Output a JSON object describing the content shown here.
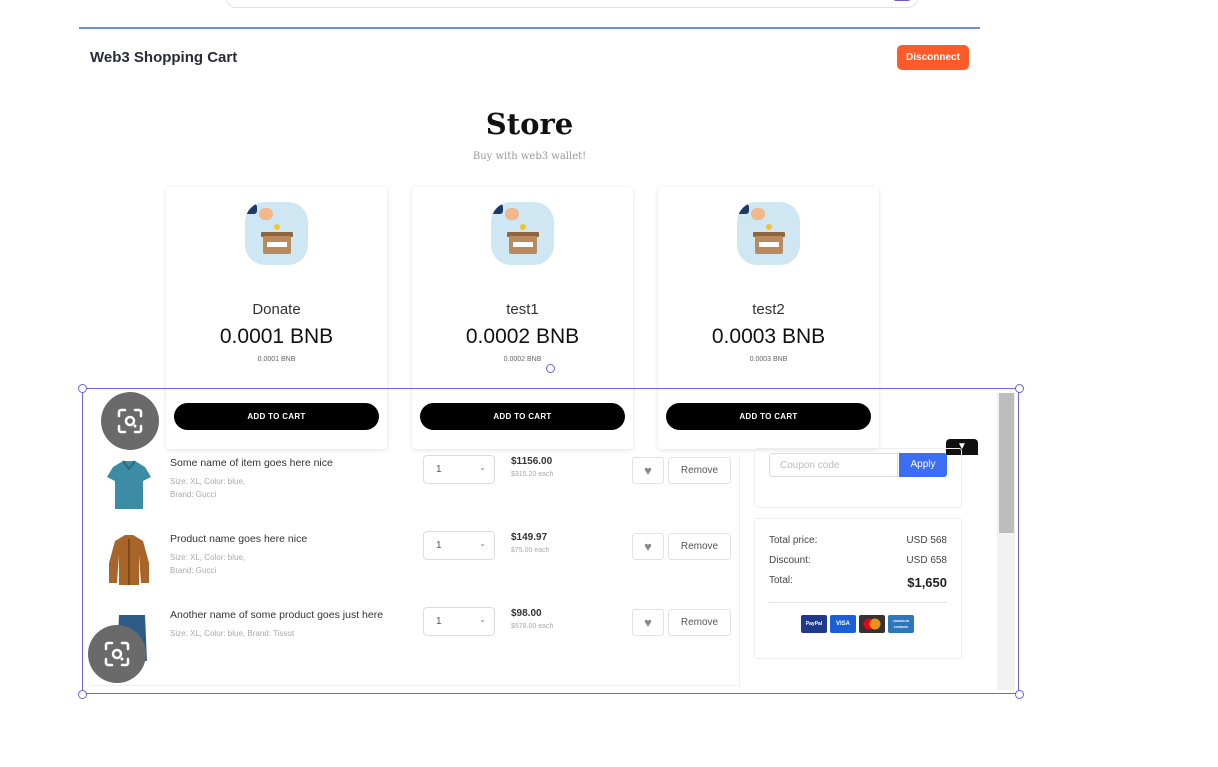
{
  "header": {
    "brand": "Web3 Shopping Cart",
    "disconnect_label": "Disconnect"
  },
  "store": {
    "title": "Store",
    "subtitle": "Buy with web3 wallet!"
  },
  "products": [
    {
      "name": "Donate",
      "price": "0.0001 BNB",
      "price_small": "0.0001 BNB",
      "button": "ADD TO CART"
    },
    {
      "name": "test1",
      "price": "0.0002 BNB",
      "price_small": "0.0002 BNB",
      "button": "ADD TO CART"
    },
    {
      "name": "test2",
      "price": "0.0003 BNB",
      "price_small": "0.0003 BNB",
      "button": "ADD TO CART"
    }
  ],
  "cart": {
    "items": [
      {
        "name": "Some name of item goes here nice",
        "meta_line1": "Size: XL, Color: blue,",
        "meta_line2": "Brand: Gucci",
        "qty": "1",
        "total": "$1156.00",
        "each": "$315.20 each",
        "remove": "Remove"
      },
      {
        "name": "Product name goes here nice",
        "meta_line1": "Size: XL, Color: blue,",
        "meta_line2": "Brand: Gucci",
        "qty": "1",
        "total": "$149.97",
        "each": "$75.00 each",
        "remove": "Remove"
      },
      {
        "name": "Another name of some product goes just here",
        "meta_line1": "Size: XL, Color: blue, Brand: Tissot",
        "meta_line2": "",
        "qty": "1",
        "total": "$98.00",
        "each": "$578.00 each",
        "remove": "Remove"
      }
    ],
    "coupon_placeholder": "Coupon code",
    "apply_label": "Apply",
    "totals": {
      "total_price_label": "Total price:",
      "total_price_value": "USD 568",
      "discount_label": "Discount:",
      "discount_value": "USD 658",
      "total_label": "Total:",
      "total_value": "$1,650"
    },
    "payment_methods": [
      "PayPal",
      "VISA",
      "mastercard-icon",
      "AMERICAN EXPRESS"
    ]
  },
  "colors": {
    "accent_orange": "#ff5a2a",
    "apply_blue": "#3b6ef2",
    "selection_purple": "#6c63e0"
  }
}
